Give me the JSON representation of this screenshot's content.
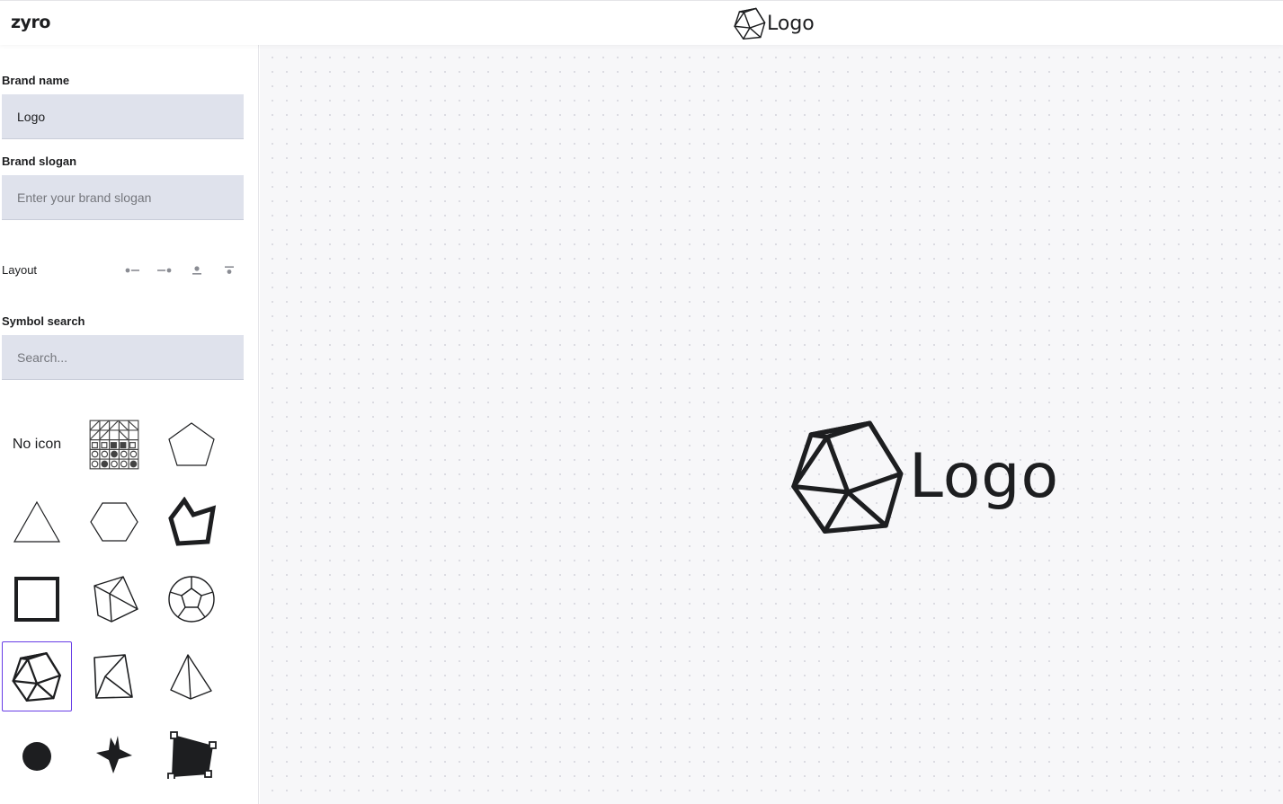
{
  "app": {
    "logo_text": "zyro"
  },
  "header": {
    "preview_text": "Logo",
    "preview_icon": "icosahedron-icon"
  },
  "sidebar": {
    "brand_name": {
      "label": "Brand name",
      "value": "Logo"
    },
    "brand_slogan": {
      "label": "Brand slogan",
      "placeholder": "Enter your brand slogan",
      "value": ""
    },
    "layout": {
      "label": "Layout",
      "options": [
        "icon-left-layout",
        "icon-right-layout",
        "icon-top-layout",
        "icon-top-compact-layout"
      ]
    },
    "symbol_search": {
      "label": "Symbol search",
      "placeholder": "Search..."
    },
    "symbols": {
      "no_icon_label": "No icon",
      "items": [
        "no-icon",
        "pattern-grid-icon",
        "pentagon-icon",
        "triangle-icon",
        "hexagon-icon",
        "crown-polygon-icon",
        "square-icon",
        "cube-icon",
        "dodecahedron-icon",
        "icosahedron-icon",
        "kite-polyhedron-icon",
        "tetrahedron-icon",
        "circle-icon",
        "star-icon",
        "transform-shape-icon"
      ],
      "selected": "icosahedron-icon"
    }
  },
  "canvas": {
    "preview_text": "Logo",
    "preview_icon": "icosahedron-icon"
  },
  "colors": {
    "selection": "#673de6",
    "input_bg": "#dfe2ec",
    "canvas_bg": "#f7f7f9"
  }
}
